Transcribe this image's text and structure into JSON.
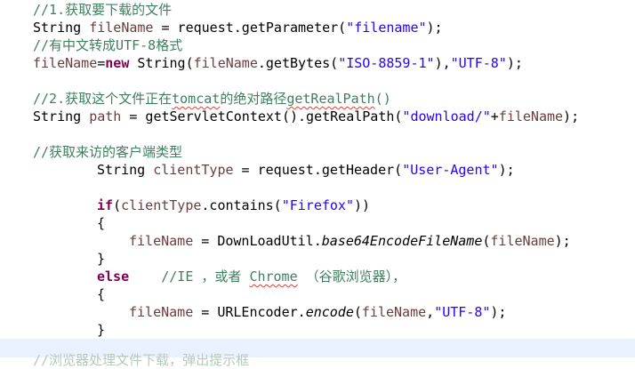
{
  "code": {
    "l1_comment": "//1.获取要下载的文件",
    "l2_type": "String",
    "l2_var": "fileName",
    "l2_eq": " = request.getParameter(",
    "l2_str": "\"filename\"",
    "l2_end": ");",
    "l3_comment": "//有中文转成UTF-8格式",
    "l4_var": "fileName",
    "l4_eq": "=",
    "l4_new": "new",
    "l4_mid": " String(",
    "l4_var2": "fileName",
    "l4_call": ".getBytes(",
    "l4_str1": "\"ISO-8859-1\"",
    "l4_comma": "),",
    "l4_str2": "\"UTF-8\"",
    "l4_end": ");",
    "l6_comment_a": "//2.获取这个文件正在",
    "l6_comment_b": "tomcat",
    "l6_comment_c": "的绝对路径",
    "l6_comment_d": "getRealPath",
    "l6_comment_e": "()",
    "l7_type": "String",
    "l7_var": "path",
    "l7_eq": " = getServletContext().getRealPath(",
    "l7_str": "\"download/\"",
    "l7_plus": "+",
    "l7_var2": "fileName",
    "l7_end": ");",
    "l9_comment": "//获取来访的客户端类型",
    "l10_type": "String",
    "l10_var": "clientType",
    "l10_eq": " = request.getHeader(",
    "l10_str": "\"User-Agent\"",
    "l10_end": ");",
    "l12_if": "if",
    "l12_open": "(",
    "l12_var": "clientType",
    "l12_call": ".contains(",
    "l12_str": "\"Firefox\"",
    "l12_end": "))",
    "l13_brace": "{",
    "l14_var": "fileName",
    "l14_eq": " = DownLoadUtil.",
    "l14_method": "base64EncodeFileName",
    "l14_open": "(",
    "l14_var2": "fileName",
    "l14_end": ");",
    "l15_brace": "}",
    "l16_else": "else",
    "l16_comment_a": "//IE ，或者 ",
    "l16_comment_b": "Chrome",
    "l16_comment_c": " （谷歌浏览器），",
    "l17_brace": "{",
    "l18_var": "fileName",
    "l18_eq": " = URLEncoder.",
    "l18_method": "encode",
    "l18_open": "(",
    "l18_var2": "fileName",
    "l18_comma": ",",
    "l18_str": "\"UTF-8\"",
    "l18_end": ");",
    "l19_brace": "}",
    "l20_partial": "//浏览器处理文件下载，弹出提示框"
  },
  "colors": {
    "comment": "#3f7f5f",
    "keyword": "#7f0055",
    "string": "#2a00ff",
    "variable": "#6a3e3e",
    "current_line": "#e8f2fe"
  }
}
